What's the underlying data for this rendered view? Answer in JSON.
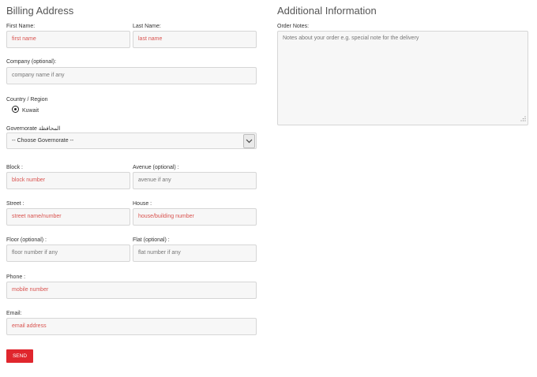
{
  "billing": {
    "title": "Billing Address",
    "first_name": {
      "label": "First Name:",
      "placeholder": "first name"
    },
    "last_name": {
      "label": "Last Name:",
      "placeholder": "last name"
    },
    "company": {
      "label": "Company (optional):",
      "placeholder": "company name if any"
    },
    "country": {
      "label": "Country / Region",
      "value": "Kuwait"
    },
    "governorate": {
      "label": "Governorate المحافظة",
      "selected": "-- Choose Governorate --"
    },
    "block": {
      "label": "Block :",
      "placeholder": "block number"
    },
    "avenue": {
      "label": "Avenue (optional) :",
      "placeholder": "avenue if any"
    },
    "street": {
      "label": "Street :",
      "placeholder": "street name/number"
    },
    "house": {
      "label": "House :",
      "placeholder": "house/building number"
    },
    "floor": {
      "label": "Floor (optional) :",
      "placeholder": "floor number if any"
    },
    "flat": {
      "label": "Flat (optional) :",
      "placeholder": "flat number if any"
    },
    "phone": {
      "label": "Phone :",
      "placeholder": "mobile number"
    },
    "email": {
      "label": "Email:",
      "placeholder": "email address"
    },
    "send_label": "SEND"
  },
  "additional": {
    "title": "Additional Information",
    "order_notes": {
      "label": "Order Notes:",
      "placeholder": "Notes about your order e.g. special note for the delivery"
    }
  },
  "colors": {
    "accent": "#e0262d",
    "placeholder_red": "#d9534f",
    "field_bg": "#f7f7f7"
  },
  "icons": {
    "select": "chevron-down-icon",
    "radio": "radio-selected-icon",
    "resize": "resize-grip-icon"
  }
}
